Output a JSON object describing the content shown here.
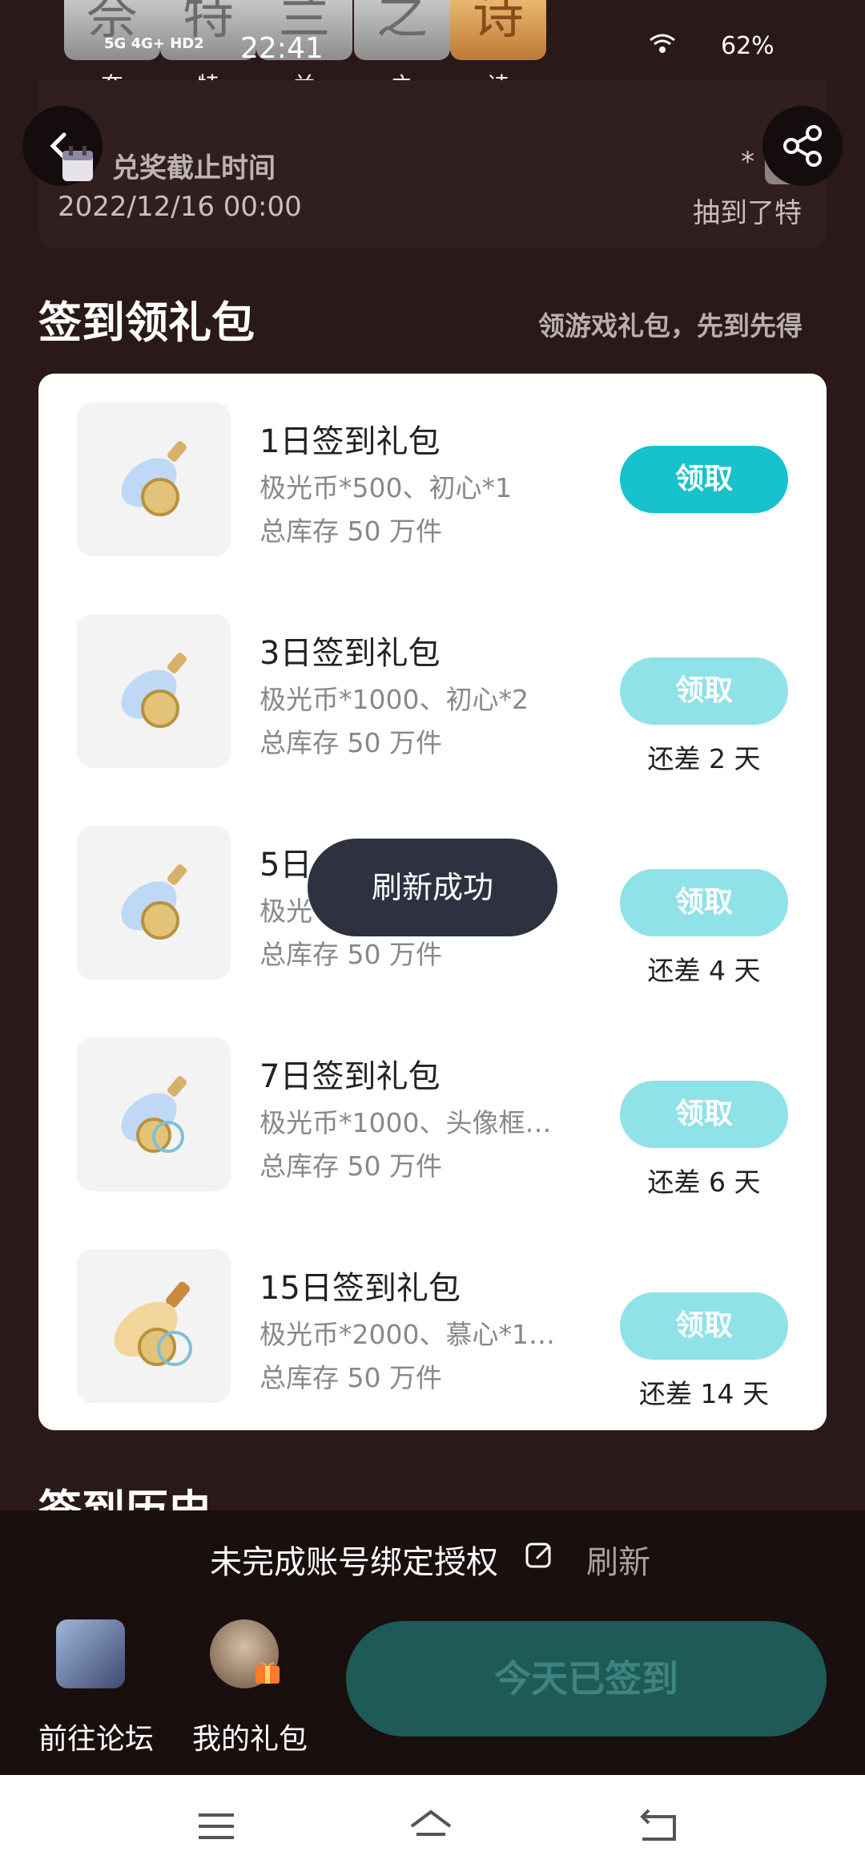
{
  "top_tiles": [
    {
      "char": "奈",
      "label": "奈"
    },
    {
      "char": "特",
      "label": "特"
    },
    {
      "char": "兰",
      "label": "兰"
    },
    {
      "char": "之",
      "label": "之"
    },
    {
      "char": "诗",
      "label": "诗"
    }
  ],
  "status_bar": {
    "network": "5G 4G+ HD2",
    "time": "22:41",
    "battery": "62%"
  },
  "header": {
    "deadline_label": "兑奖截止时间",
    "deadline_date": "2022/12/16 00:00",
    "right_star": "*",
    "right_text": "抽到了特"
  },
  "section": {
    "title": "签到领礼包",
    "subtitle": "领游戏礼包，先到先得"
  },
  "gifts": [
    {
      "name": "1日签到礼包",
      "desc": "极光币*500、初心*1",
      "stock": "总库存 50 万件",
      "button": "领取",
      "remain": ""
    },
    {
      "name": "3日签到礼包",
      "desc": "极光币*1000、初心*2",
      "stock": "总库存 50 万件",
      "button": "领取",
      "remain": "还差 2 天"
    },
    {
      "name": "5日",
      "desc": "极光",
      "stock": "总库存 50 万件",
      "button": "领取",
      "remain": "还差 4 天"
    },
    {
      "name": "7日签到礼包",
      "desc": "极光币*1000、头像框…",
      "stock": "总库存 50 万件",
      "button": "领取",
      "remain": "还差 6 天"
    },
    {
      "name": "15日签到礼包",
      "desc": "极光币*2000、慕心*1…",
      "stock": "总库存 50 万件",
      "button": "领取",
      "remain": "还差 14 天"
    }
  ],
  "toast": "刷新成功",
  "history_title": "签到历史",
  "bottom": {
    "bind_text": "未完成账号绑定授权",
    "refresh": "刷新",
    "forum_label": "前往论坛",
    "mygifts_label": "我的礼包",
    "signed_button": "今天已签到"
  },
  "colors": {
    "accent": "#17c2cc",
    "accent_disabled": "#8fe2e8",
    "background": "#2a1918",
    "signed_button": "#1e5b58"
  }
}
